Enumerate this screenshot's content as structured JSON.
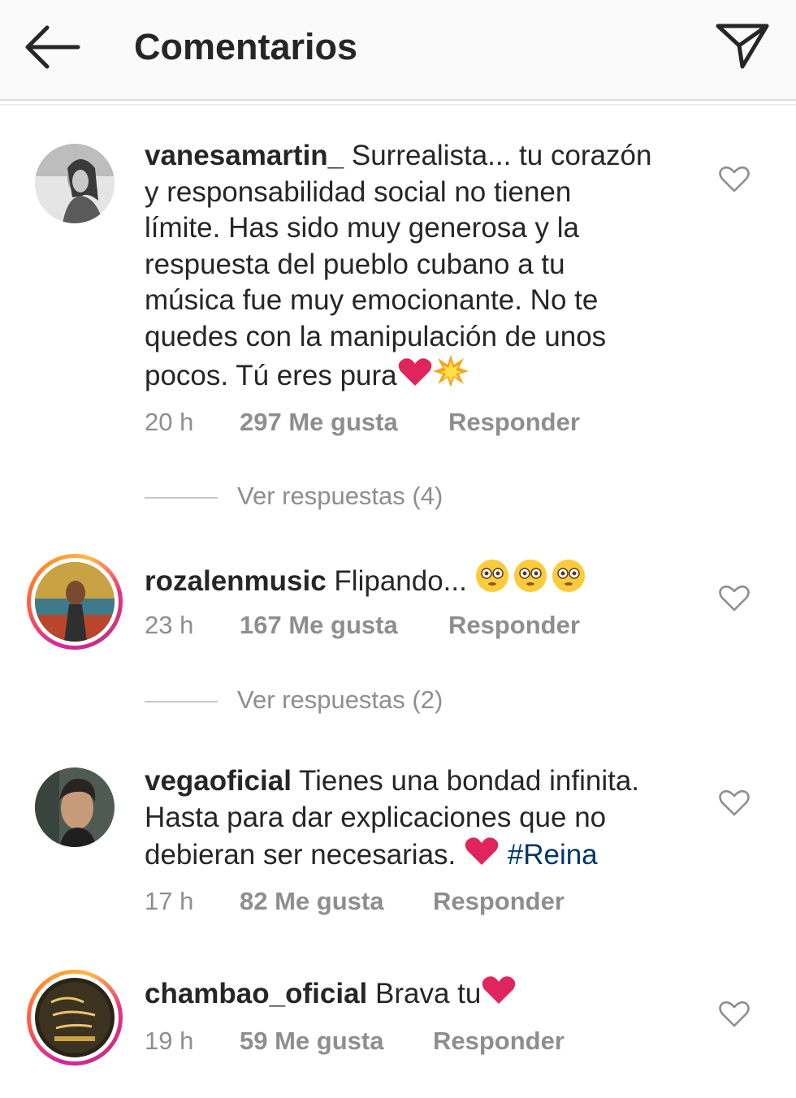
{
  "header": {
    "title": "Comentarios",
    "back_icon": "arrow-left-icon",
    "send_icon": "paper-plane-icon"
  },
  "colors": {
    "text": "#262626",
    "meta": "#8e8e8e",
    "hashtag": "#003569",
    "heart_emoji": "#e0245e",
    "story_ring": "#d6249f"
  },
  "comments": [
    {
      "username": "vanesamartin_",
      "text_lines": [
        " Surrealista... tu corazón",
        "y responsabilidad social no tienen",
        "límite. Has sido muy generosa y la",
        "respuesta del pueblo cubano a tu",
        "música fue muy emocionante. No te",
        "quedes con la manipulación de unos",
        "pocos. Tú eres pura"
      ],
      "emoji_after": "❤️💥",
      "time": "20 h",
      "likes": "297 Me gusta",
      "reply": "Responder",
      "view_replies": "Ver respuestas (4)"
    },
    {
      "username": "rozalenmusic",
      "text": " Flipando... ",
      "emoji_after": "😳😳😳",
      "time": "23 h",
      "likes": "167 Me gusta",
      "reply": "Responder",
      "view_replies": "Ver respuestas (2)"
    },
    {
      "username": "vegaoficial",
      "text_lines": [
        " Tienes una bondad infinita.",
        "Hasta para dar explicaciones que no",
        "debieran ser necesarias. "
      ],
      "emoji_after": "❤️",
      "hashtag": "#Reina",
      "time": "17 h",
      "likes": "82 Me gusta",
      "reply": "Responder"
    },
    {
      "username": "chambao_oficial",
      "text": " Brava tu",
      "emoji_after": "❤️",
      "time": "19 h",
      "likes": "59 Me gusta",
      "reply": "Responder"
    }
  ]
}
